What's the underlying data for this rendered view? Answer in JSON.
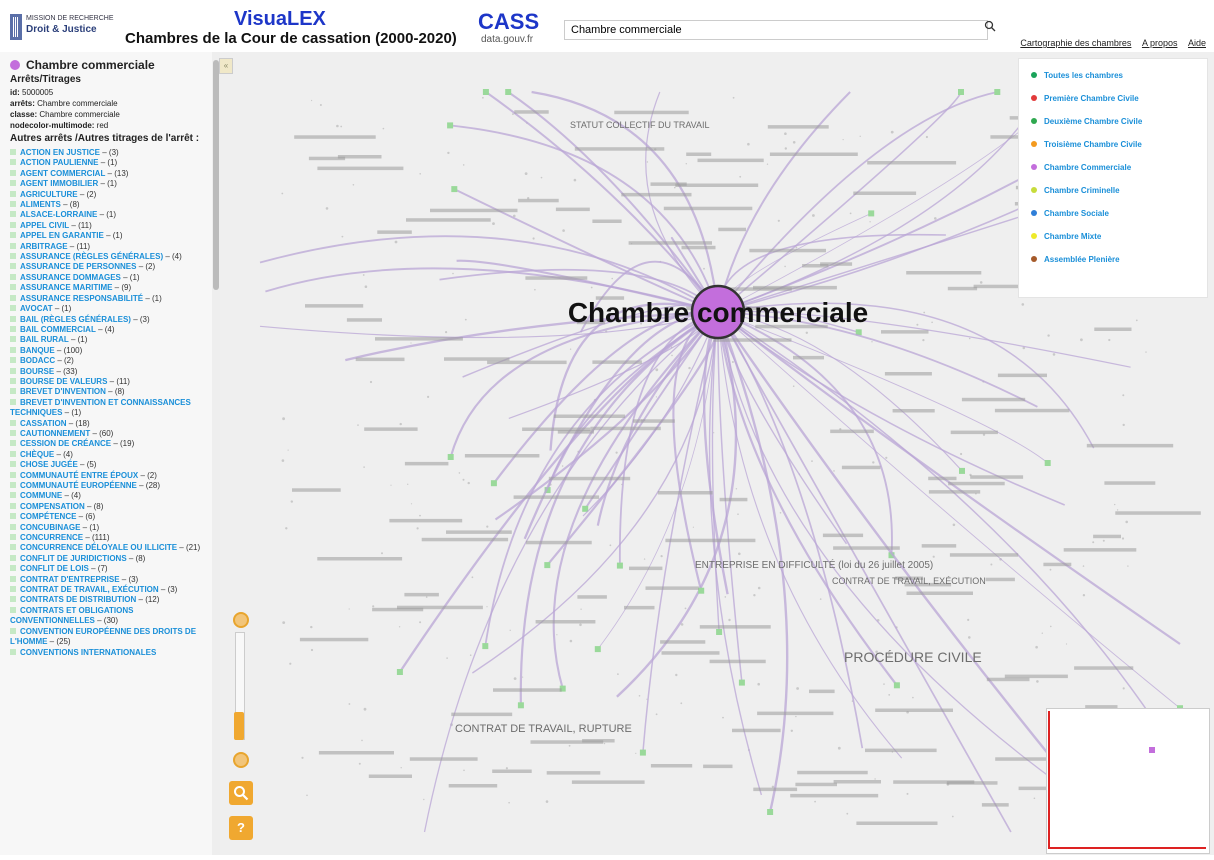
{
  "header": {
    "logo_line1": "MISSION DE RECHERCHE",
    "logo_line2": "Droit & Justice",
    "app_title": "VisuaLEX",
    "app_subtitle": "Chambres de la Cour de cassation (2000-2020)",
    "cass_title": "CASS",
    "cass_sub": "data.gouv.fr",
    "search_value": "Chambre commerciale",
    "nav": [
      "Cartographie des chambres",
      "A propos",
      "Aide"
    ]
  },
  "sidebar": {
    "title": "Chambre commerciale",
    "title_color": "#c36edc",
    "section_title": "Arrêts/Titrages",
    "meta": [
      {
        "key": "id:",
        "value": "5000005"
      },
      {
        "key": "arrêts:",
        "value": "Chambre commerciale"
      },
      {
        "key": "classe:",
        "value": "Chambre commerciale"
      },
      {
        "key": "nodecolor-multimode:",
        "value": "red"
      }
    ],
    "list_title": "Autres arrêts /Autres titrages de l'arrêt :",
    "items": [
      {
        "label": "ACTION EN JUSTICE",
        "count": "– (3)"
      },
      {
        "label": "ACTION PAULIENNE",
        "count": "– (1)"
      },
      {
        "label": "AGENT COMMERCIAL",
        "count": "– (13)"
      },
      {
        "label": "AGENT IMMOBILIER",
        "count": "– (1)"
      },
      {
        "label": "AGRICULTURE",
        "count": "– (2)"
      },
      {
        "label": "ALIMENTS",
        "count": "– (8)"
      },
      {
        "label": "ALSACE-LORRAINE",
        "count": "– (1)"
      },
      {
        "label": "APPEL CIVIL",
        "count": "– (11)"
      },
      {
        "label": "APPEL EN GARANTIE",
        "count": "– (1)"
      },
      {
        "label": "ARBITRAGE",
        "count": "– (11)"
      },
      {
        "label": "ASSURANCE (RÈGLES GÉNÉRALES)",
        "count": "– (4)"
      },
      {
        "label": "ASSURANCE DE PERSONNES",
        "count": "– (2)"
      },
      {
        "label": "ASSURANCE DOMMAGES",
        "count": "– (1)"
      },
      {
        "label": "ASSURANCE MARITIME",
        "count": "– (9)"
      },
      {
        "label": "ASSURANCE RESPONSABILITÉ",
        "count": "– (1)"
      },
      {
        "label": "AVOCAT",
        "count": "– (1)"
      },
      {
        "label": "BAIL (RÈGLES GÉNÉRALES)",
        "count": "– (3)"
      },
      {
        "label": "BAIL COMMERCIAL",
        "count": "– (4)"
      },
      {
        "label": "BAIL RURAL",
        "count": "– (1)"
      },
      {
        "label": "BANQUE",
        "count": "– (100)"
      },
      {
        "label": "BODACC",
        "count": "– (2)"
      },
      {
        "label": "BOURSE",
        "count": "– (33)"
      },
      {
        "label": "BOURSE DE VALEURS",
        "count": "– (11)"
      },
      {
        "label": "BREVET D'INVENTION",
        "count": "– (8)"
      },
      {
        "label": "BREVET D'INVENTION ET CONNAISSANCES TECHNIQUES",
        "count": "– (1)"
      },
      {
        "label": "CASSATION",
        "count": "– (18)"
      },
      {
        "label": "CAUTIONNEMENT",
        "count": "– (60)"
      },
      {
        "label": "CESSION DE CRÉANCE",
        "count": "– (19)"
      },
      {
        "label": "CHÈQUE",
        "count": "– (4)"
      },
      {
        "label": "CHOSE JUGÉE",
        "count": "– (5)"
      },
      {
        "label": "COMMUNAUTÉ ENTRE ÉPOUX",
        "count": "– (2)"
      },
      {
        "label": "COMMUNAUTÉ EUROPÉENNE",
        "count": "– (28)"
      },
      {
        "label": "COMMUNE",
        "count": "– (4)"
      },
      {
        "label": "COMPENSATION",
        "count": "– (8)"
      },
      {
        "label": "COMPÉTENCE",
        "count": "– (6)"
      },
      {
        "label": "CONCUBINAGE",
        "count": "– (1)"
      },
      {
        "label": "CONCURRENCE",
        "count": "– (111)"
      },
      {
        "label": "CONCURRENCE DÉLOYALE OU ILLICITE",
        "count": "– (21)"
      },
      {
        "label": "CONFLIT DE JURIDICTIONS",
        "count": "– (8)"
      },
      {
        "label": "CONFLIT DE LOIS",
        "count": "– (7)"
      },
      {
        "label": "CONTRAT D'ENTREPRISE",
        "count": "– (3)"
      },
      {
        "label": "CONTRAT DE TRAVAIL, EXÉCUTION",
        "count": "– (3)"
      },
      {
        "label": "CONTRATS DE DISTRIBUTION",
        "count": "– (12)"
      },
      {
        "label": "CONTRATS ET OBLIGATIONS CONVENTIONNELLES",
        "count": "– (30)"
      },
      {
        "label": "CONVENTION EUROPÉENNE DES DROITS DE L'HOMME",
        "count": "– (25)"
      },
      {
        "label": "CONVENTIONS INTERNATIONALES",
        "count": ""
      }
    ]
  },
  "graph": {
    "center_label": "Chambre commerciale",
    "center_color": "#c36edc",
    "edge_color": "#b9a5d6",
    "big_labels": [
      "PROCÉDURE CIVILE",
      "CONTRAT DE TRAVAIL, RUPTURE",
      "ENTREPRISE EN DIFFICULTÉ (loi du 26 juillet 2005)",
      "CONTRAT DE TRAVAIL, EXÉCUTION",
      "STATUT COLLECTIF DU TRAVAIL"
    ]
  },
  "legend": [
    {
      "label": "Toutes les chambres",
      "color": "#1aa35a"
    },
    {
      "label": "Première Chambre Civile",
      "color": "#e23a3a"
    },
    {
      "label": "Deuxième Chambre Civile",
      "color": "#2fa84f"
    },
    {
      "label": "Troisième Chambre Civile",
      "color": "#f39a1f"
    },
    {
      "label": "Chambre Commerciale",
      "color": "#c36edc"
    },
    {
      "label": "Chambre Criminelle",
      "color": "#c7dc3b"
    },
    {
      "label": "Chambre Sociale",
      "color": "#2f7fd8"
    },
    {
      "label": "Chambre Mixte",
      "color": "#eeea2a"
    },
    {
      "label": "Assemblée Plenière",
      "color": "#a55a2a"
    }
  ],
  "tools": {
    "search_icon": "magnifier-icon",
    "help_icon": "question-icon"
  }
}
